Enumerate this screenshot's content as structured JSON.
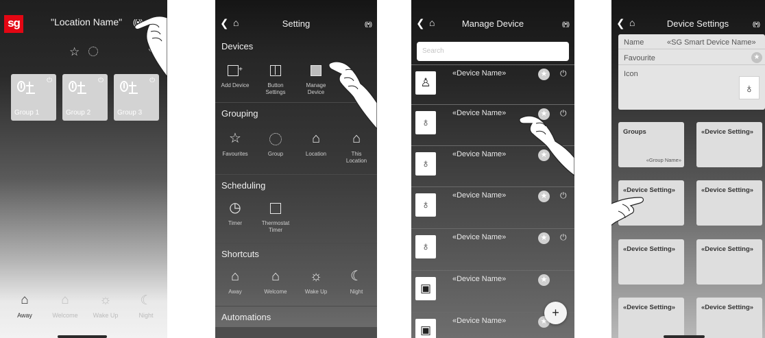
{
  "home": {
    "logo": "sg",
    "location": "\"Location Name\"",
    "groups": [
      {
        "name": "Group 1"
      },
      {
        "name": "Group 2"
      },
      {
        "name": "Group 3"
      }
    ],
    "shortcuts": [
      {
        "label": "Away",
        "active": true
      },
      {
        "label": "Welcome",
        "active": false
      },
      {
        "label": "Wake Up",
        "active": false
      },
      {
        "label": "Night",
        "active": false
      }
    ]
  },
  "setting": {
    "title": "Setting",
    "sections": [
      {
        "title": "Devices",
        "items": [
          "Add Device",
          "Button\nSettings",
          "Manage\nDevice"
        ]
      },
      {
        "title": "Grouping",
        "items": [
          "Favourites",
          "Group",
          "Location",
          "This\nLocation"
        ]
      },
      {
        "title": "Scheduling",
        "items": [
          "Timer",
          "Thermostat\nTimer"
        ]
      },
      {
        "title": "Shortcuts",
        "items": [
          "Away",
          "Welcome",
          "Wake Up",
          "Night"
        ]
      },
      {
        "title": "Automations",
        "items": []
      }
    ]
  },
  "manage": {
    "title": "Manage Device",
    "search_placeholder": "Search",
    "devices": [
      {
        "name": "«Device Name»",
        "icon": "plug-icon",
        "favourite": true,
        "power": true
      },
      {
        "name": "«Device Name»",
        "icon": "bulb-icon",
        "favourite": true,
        "power": true
      },
      {
        "name": "«Device Name»",
        "icon": "bulb-icon",
        "favourite": true,
        "power": false
      },
      {
        "name": "«Device Name»",
        "icon": "bulb-icon",
        "favourite": true,
        "power": true
      },
      {
        "name": "«Device Name»",
        "icon": "bulb-icon",
        "favourite": true,
        "power": true
      },
      {
        "name": "«Device Name»",
        "icon": "thermostat-icon",
        "favourite": true,
        "power": false
      },
      {
        "name": "«Device Name»",
        "icon": "thermostat-icon",
        "favourite": true,
        "power": false
      }
    ],
    "add_label": "+"
  },
  "device_settings": {
    "title": "Device Settings",
    "name_label": "Name",
    "name_value": "«SG Smart Device Name»",
    "favourite_label": "Favourite",
    "icon_label": "Icon",
    "groups_title": "Groups",
    "group_name": "«Group Name»",
    "setting_label": "«Device Setting»"
  },
  "colors": {
    "brand_red": "#e30613"
  }
}
